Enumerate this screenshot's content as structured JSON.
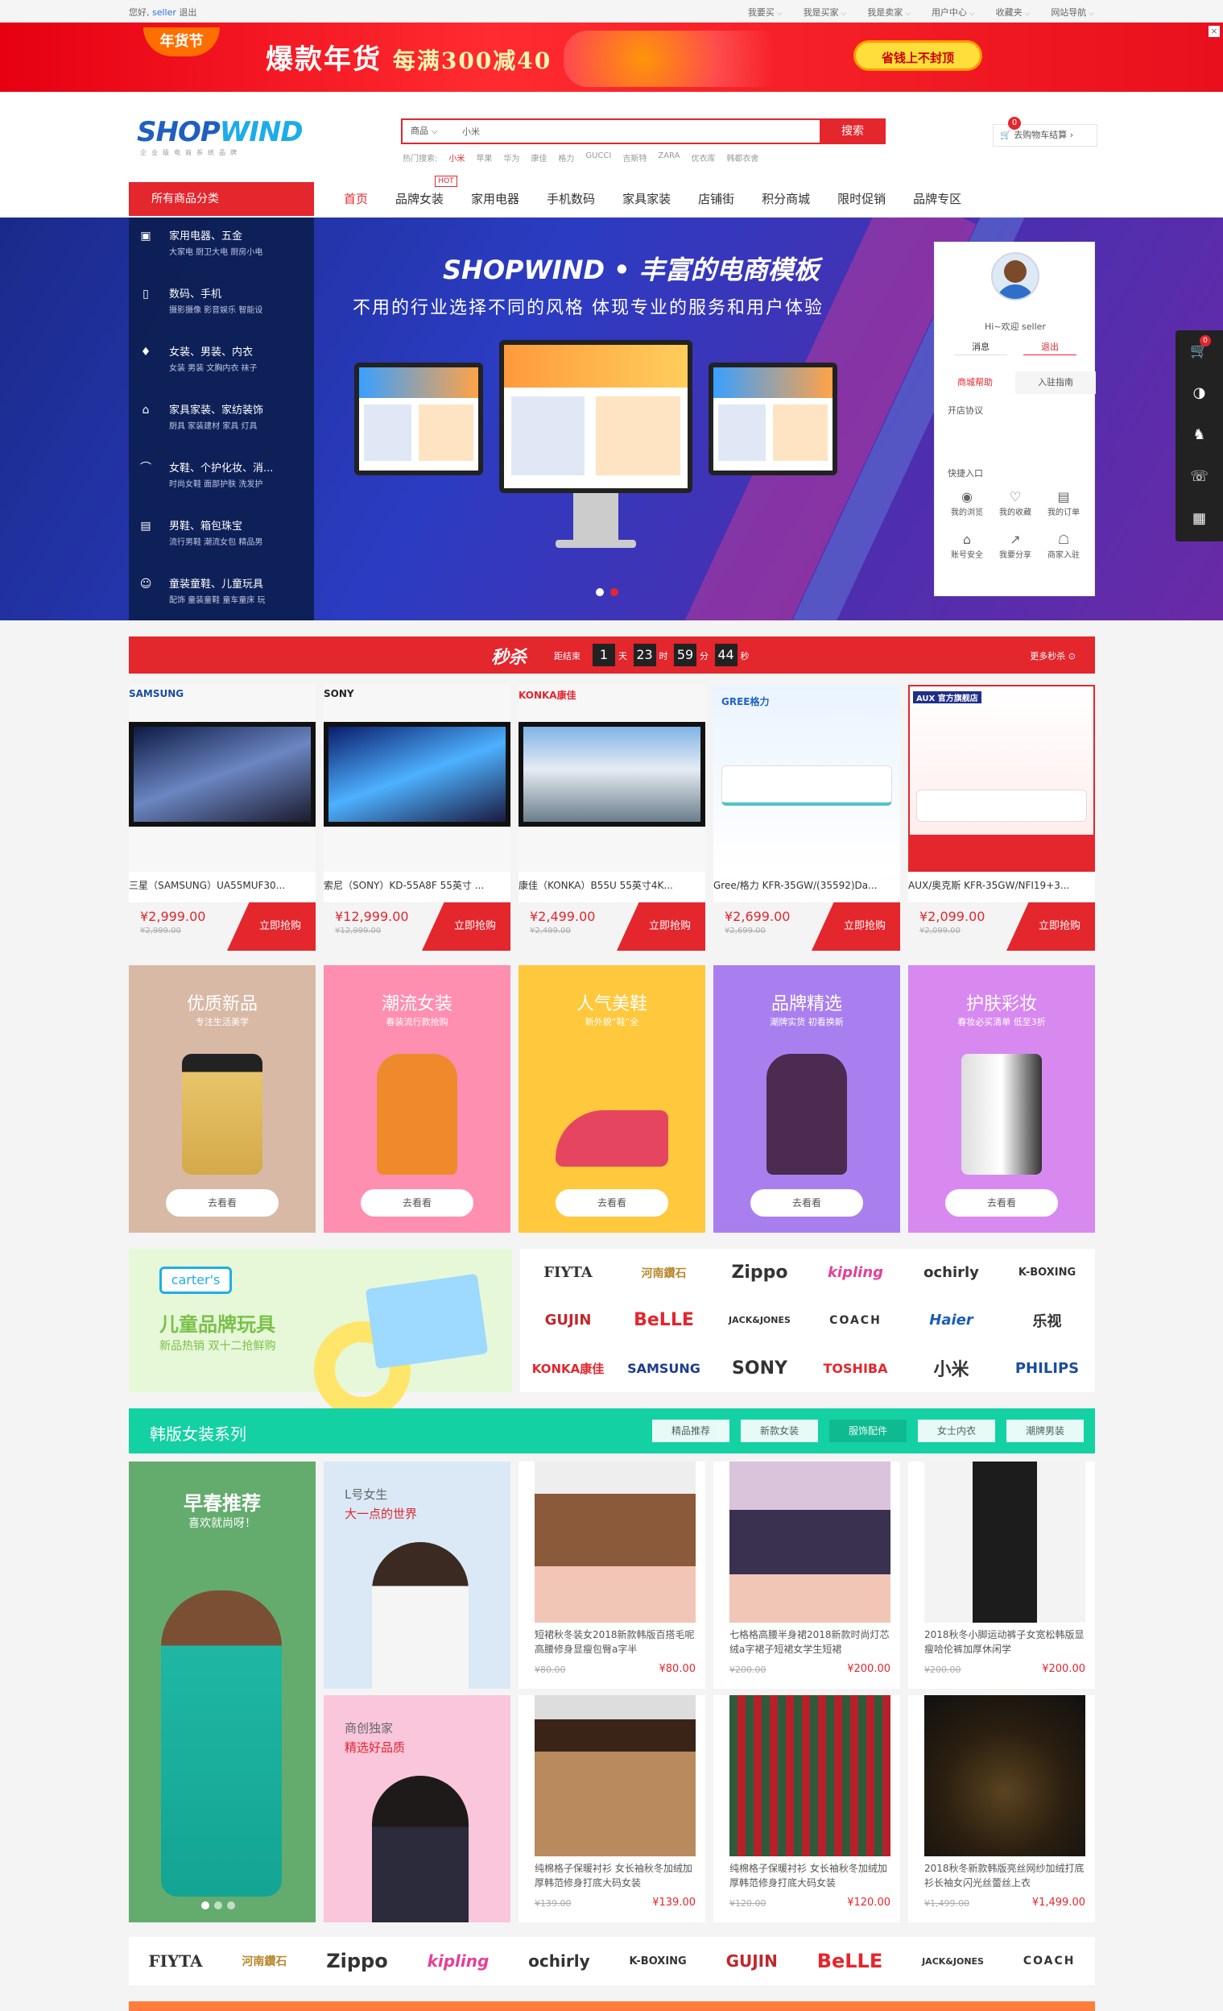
{
  "topbar": {
    "greeting": "您好,",
    "user": "seller",
    "logout": "退出",
    "links": [
      "我要买",
      "我是买家",
      "我是卖家",
      "用户中心",
      "收藏夹",
      "网站导航"
    ]
  },
  "banner": {
    "tag": "年货节",
    "headline": "爆款年货",
    "headline_sub": "每满300减40",
    "pill": "省钱上不封顶",
    "close": "×"
  },
  "logo": {
    "text_a": "SHOP",
    "text_b": "WIND",
    "tagline": "企业级电商系统品牌"
  },
  "search": {
    "scope": "商品",
    "value": "小米",
    "button": "搜索",
    "hot_label": "热门搜索:",
    "hot": [
      "小米",
      "苹果",
      "华为",
      "康佳",
      "格力",
      "GUCCI",
      "吉斯特",
      "ZARA",
      "优衣库",
      "韩都衣舍"
    ]
  },
  "cart": {
    "label": "去购物车结算",
    "count": "0"
  },
  "nav": {
    "all": "所有商品分类",
    "items": [
      "首页",
      "品牌女装",
      "家用电器",
      "手机数码",
      "家具家装",
      "店铺街",
      "积分商城",
      "限时促销",
      "品牌专区"
    ],
    "hot": "HOT"
  },
  "categories": [
    {
      "icon": "▣",
      "title": "家用电器、五金",
      "sub": "大家电  厨卫大电  厨房小电"
    },
    {
      "icon": "▯",
      "title": "数码、手机",
      "sub": "摄影摄像  影音娱乐  智能设"
    },
    {
      "icon": "♦",
      "title": "女装、男装、内衣",
      "sub": "女装  男装  文胸内衣  袜子"
    },
    {
      "icon": "⌂",
      "title": "家具家装、家纺装饰",
      "sub": "厨具  家装建材  家具  灯具"
    },
    {
      "icon": "⌒",
      "title": "女鞋、个护化妆、消...",
      "sub": "时尚女鞋  面部护肤  洗发护"
    },
    {
      "icon": "▤",
      "title": "男鞋、箱包珠宝",
      "sub": "流行男鞋  潮流女包  精品男"
    },
    {
      "icon": "☺",
      "title": "童装童鞋、儿童玩具",
      "sub": "配饰  童装童鞋  童车童床  玩"
    }
  ],
  "hero": {
    "title": "SHOPWIND • 丰富的电商模板",
    "subtitle": "不用的行业选择不同的风格  体现专业的服务和用户体验"
  },
  "userpanel": {
    "hi": "Hi~欢迎 seller",
    "msg": "消息",
    "logout": "退出",
    "tab1": "商城帮助",
    "tab2": "入驻指南",
    "notice": "开店协议",
    "quick": "快捷入口",
    "links": [
      {
        "icon": "◉",
        "label": "我的浏览"
      },
      {
        "icon": "♡",
        "label": "我的收藏"
      },
      {
        "icon": "▤",
        "label": "我的订单"
      },
      {
        "icon": "⌂",
        "label": "账号安全"
      },
      {
        "icon": "↗",
        "label": "我要分享"
      },
      {
        "icon": "☖",
        "label": "商家入驻"
      }
    ]
  },
  "floatbar": {
    "cart_count": "0",
    "icons": [
      "🛒",
      "◑",
      "♞",
      "☏",
      "▦"
    ]
  },
  "flash": {
    "title": "秒杀",
    "label": "距结束",
    "days": "1",
    "d_unit": "天",
    "hours": "23",
    "h_unit": "时",
    "mins": "59",
    "m_unit": "分",
    "secs": "44",
    "s_unit": "秒",
    "more": "更多秒杀 ⊙",
    "buy": "立即抢购",
    "items": [
      {
        "brand": "SAMSUNG",
        "name": "三星（SAMSUNG）UA55MUF30...",
        "price": "¥2,999.00",
        "orig": "¥2,999.00"
      },
      {
        "brand": "SONY",
        "name": "索尼（SONY）KD-55A8F 55英寸 ...",
        "price": "¥12,999.00",
        "orig": "¥12,999.00"
      },
      {
        "brand": "KONKA康佳",
        "name": "康佳（KONKA）B55U 55英寸4K...",
        "price": "¥2,499.00",
        "orig": "¥2,499.00"
      },
      {
        "brand": "GREE格力",
        "name": "Gree/格力 KFR-35GW/(35592)Da...",
        "price": "¥2,699.00",
        "orig": "¥2,699.00"
      },
      {
        "brand": "AUX 官方旗舰店",
        "name": "AUX/奥克斯 KFR-35GW/NFI19+3...",
        "price": "¥2,099.00",
        "orig": "¥2,099.00"
      }
    ]
  },
  "promos": [
    {
      "title": "优质新品",
      "sub": "专注生活美学",
      "go": "去看看",
      "color": "#d8b9a6"
    },
    {
      "title": "潮流女装",
      "sub": "春装流行款抢购",
      "go": "去看看",
      "color": "#ff8fb0"
    },
    {
      "title": "人气美鞋",
      "sub": "新外貌“鞋”全",
      "go": "去看看",
      "color": "#ffc83d"
    },
    {
      "title": "品牌精选",
      "sub": "潮牌实货 初看换新",
      "go": "去看看",
      "color": "#a97ff0"
    },
    {
      "title": "护肤彩妆",
      "sub": "春妆必买清单 低至3折",
      "go": "去看看",
      "color": "#d889f0"
    }
  ],
  "kids": {
    "tag": "carter's",
    "title": "儿童品牌玩具",
    "sub": "新品热销 双十二抢鲜购"
  },
  "brands": [
    "FIYTA",
    "河南鑽石",
    "Zippo",
    "kipling",
    "ochirly",
    "K-BOXING",
    "GUJIN",
    "BeLLE",
    "JACK&JONES",
    "COACH",
    "Haier",
    "乐视",
    "KONKA康佳",
    "SAMSUNG",
    "SONY",
    "TOSHIBA",
    "小米",
    "PHILIPS"
  ],
  "korea": {
    "title": "韩版女装系列",
    "tabs": [
      "精品推荐",
      "新款女装",
      "服饰配件",
      "女士内衣",
      "潮牌男装"
    ],
    "big_title": "早春推荐",
    "big_sub": "喜欢就尚呀！",
    "mid": [
      {
        "a": "L号女生",
        "b": "大一点的世界"
      },
      {
        "a": "商创独家",
        "b": "精选好品质"
      }
    ],
    "products": [
      {
        "name": "短裙秋冬装女2018新款韩版百搭毛呢高腰修身显瘦包臀a字半",
        "orig": "¥80.00",
        "price": "¥80.00"
      },
      {
        "name": "七格格高腰半身裙2018新款时尚灯芯绒a字裙子短裙女学生短裙",
        "orig": "¥200.00",
        "price": "¥200.00"
      },
      {
        "name": "2018秋冬小脚运动裤子女宽松韩版显瘦哈伦裤加厚休闲学",
        "orig": "¥200.00",
        "price": "¥200.00"
      },
      {
        "name": "纯棉格子保暖衬衫 女长袖秋冬加绒加厚韩范修身打底大码女装",
        "orig": "¥139.00",
        "price": "¥139.00"
      },
      {
        "name": "纯棉格子保暖衬衫 女长袖秋冬加绒加厚韩范修身打底大码女装",
        "orig": "¥120.00",
        "price": "¥120.00"
      },
      {
        "name": "2018秋冬新款韩版亮丝网纱加绒打底衫长袖女闪光丝蕾丝上衣",
        "orig": "¥1,499.00",
        "price": "¥1,499.00"
      }
    ]
  },
  "bottom_brands": [
    "FIYTA",
    "河南鑽石",
    "Zippo",
    "kipling",
    "ochirly",
    "K-BOXING",
    "GUJIN",
    "BeLLE",
    "JACK&JONES",
    "COACH"
  ]
}
